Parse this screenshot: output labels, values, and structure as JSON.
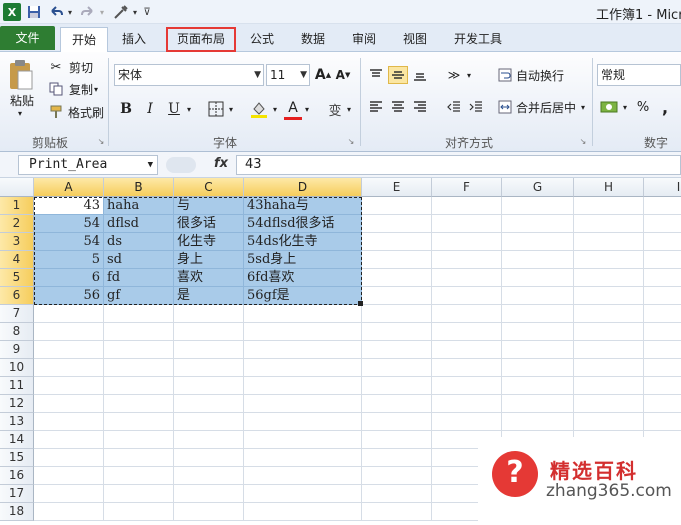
{
  "window": {
    "title": "工作簿1 - Micr"
  },
  "qat": {
    "save_icon": "save-icon",
    "undo_icon": "undo-icon",
    "redo_icon": "redo-icon"
  },
  "tabs": [
    {
      "label": "文件"
    },
    {
      "label": "开始"
    },
    {
      "label": "插入"
    },
    {
      "label": "页面布局"
    },
    {
      "label": "公式"
    },
    {
      "label": "数据"
    },
    {
      "label": "审阅"
    },
    {
      "label": "视图"
    },
    {
      "label": "开发工具"
    }
  ],
  "ribbon": {
    "clipboard": {
      "paste": "粘贴",
      "cut": "剪切",
      "copy": "复制",
      "format_painter": "格式刷",
      "group": "剪贴板"
    },
    "font": {
      "name": "宋体",
      "size": "11",
      "bold": "B",
      "italic": "I",
      "underline": "U",
      "group": "字体"
    },
    "alignment": {
      "wrap": "自动换行",
      "merge": "合并后居中",
      "group": "对齐方式"
    },
    "number": {
      "format": "常规",
      "percent": "%",
      "comma": ",",
      "group": "数字"
    }
  },
  "formula_bar": {
    "name_box": "Print_Area",
    "fx": "fx",
    "value": "43"
  },
  "columns": [
    "A",
    "B",
    "C",
    "D",
    "E",
    "F",
    "G",
    "H",
    "I"
  ],
  "rows": [
    "1",
    "2",
    "3",
    "4",
    "5",
    "6",
    "7",
    "8",
    "9",
    "10",
    "11",
    "12",
    "13",
    "14",
    "15",
    "16",
    "17",
    "18"
  ],
  "data_rows": [
    [
      "43",
      "haha",
      "与",
      "43haha与"
    ],
    [
      "54",
      "dflsd",
      "很多话",
      "54dflsd很多话"
    ],
    [
      "54",
      "ds",
      "化生寺",
      "54ds化生寺"
    ],
    [
      "5",
      "sd",
      "身上",
      "5sd身上"
    ],
    [
      "6",
      "fd",
      "喜欢",
      "6fd喜欢"
    ],
    [
      "56",
      "gf",
      "是",
      "56gf是"
    ]
  ],
  "watermark": {
    "symbol": "?",
    "title": "精选百科",
    "url": "zhang365.com"
  },
  "colors": {
    "file_tab": "#2e7d32",
    "highlight_outline": "#e53935",
    "selection": "#a9cbe9",
    "header_selected": "#f6cd5c"
  }
}
